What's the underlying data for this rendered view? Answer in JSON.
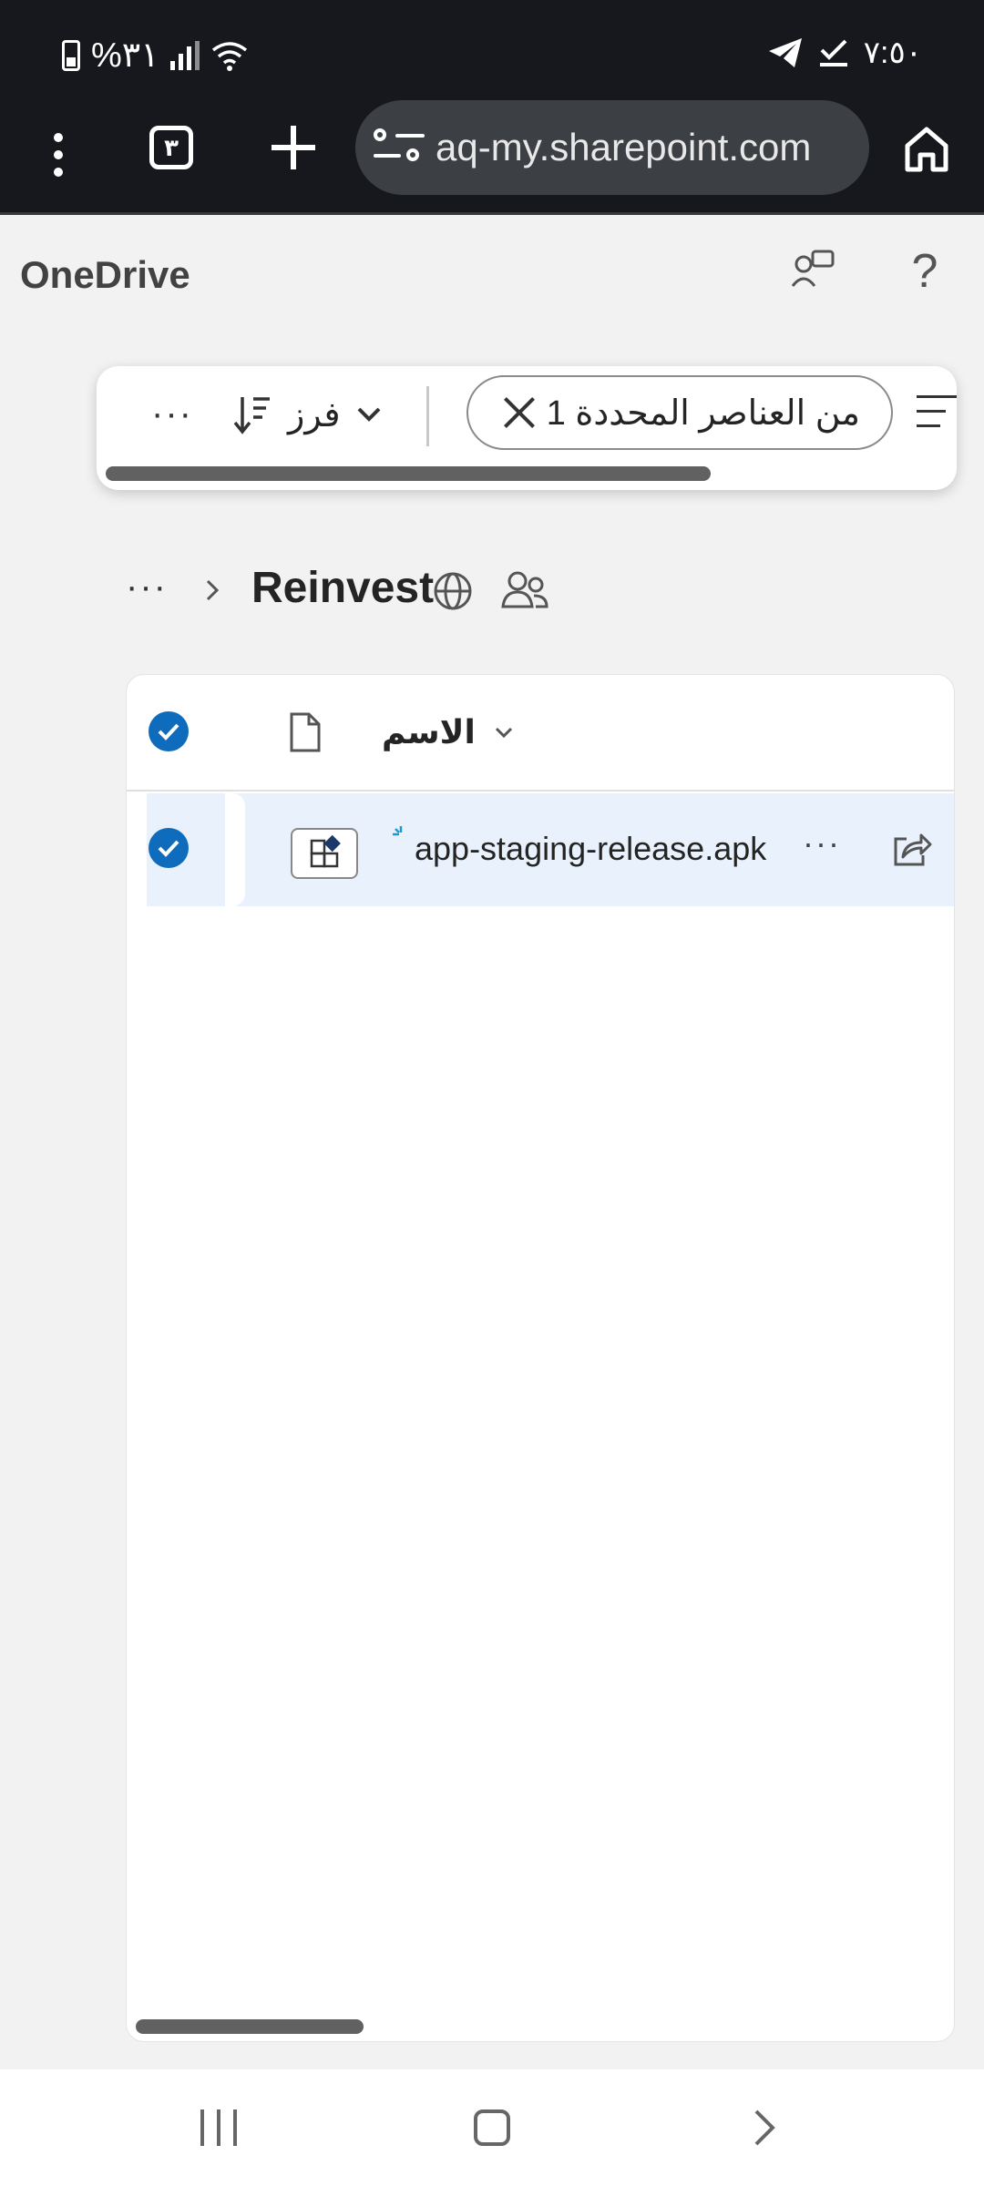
{
  "status_bar": {
    "battery_percent": "%٣١",
    "time": "٧:٥٠"
  },
  "browser": {
    "tab_count": "٣",
    "url": "aq-my.sharepoint.com"
  },
  "app": {
    "title": "OneDrive"
  },
  "command_bar": {
    "more": "···",
    "sort_label": "فرز",
    "selection_label": "من العناصر المحددة 1"
  },
  "breadcrumb": {
    "more": "···",
    "folder_title": "Reinvest"
  },
  "file_list": {
    "name_column_label": "الاسم",
    "items": [
      {
        "name": "app-staging-release.apk",
        "more": "···",
        "selected": true
      }
    ]
  },
  "colors": {
    "accent": "#0f6cbd",
    "selected_row": "#e9f2fc"
  }
}
